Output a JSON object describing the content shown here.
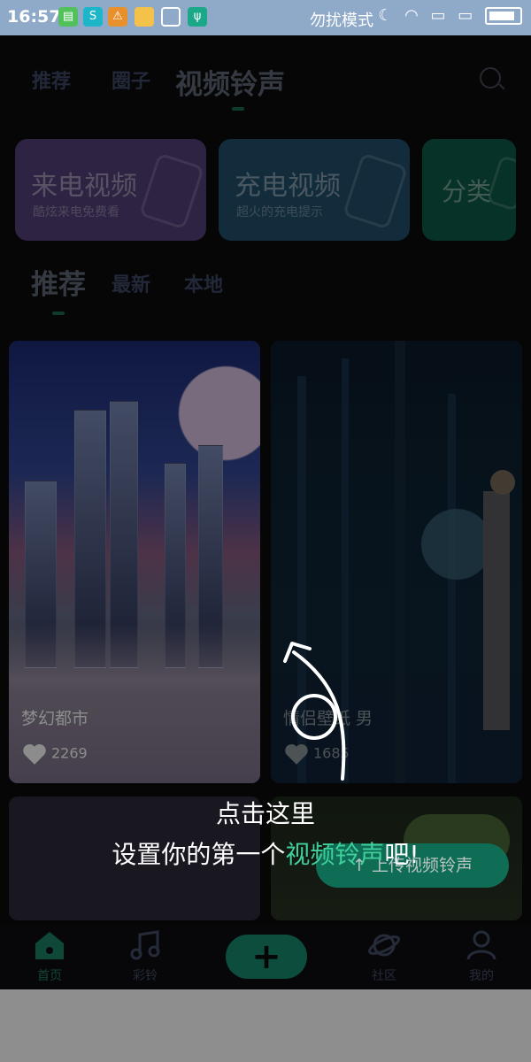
{
  "status_bar": {
    "time": "16:57",
    "dnd_text": "勿扰模式"
  },
  "top_tabs": [
    {
      "label": "推荐"
    },
    {
      "label": "圈子"
    },
    {
      "label": "视频铃声"
    }
  ],
  "category_cards": [
    {
      "title": "来电视频",
      "subtitle": "酷炫来电免费看",
      "color": "#6a4a8e"
    },
    {
      "title": "充电视频",
      "subtitle": "超火的充电提示",
      "color": "#275e80"
    },
    {
      "title": "分类",
      "subtitle": "",
      "color": "#0f6e58"
    }
  ],
  "sub_tabs": [
    {
      "label": "推荐"
    },
    {
      "label": "最新"
    },
    {
      "label": "本地"
    }
  ],
  "videos": [
    {
      "name": "梦幻都市",
      "likes": "2269"
    },
    {
      "name": "情侣壁纸 男",
      "likes": "1685"
    }
  ],
  "upload_button": {
    "label": "↑ 上传视频铃声"
  },
  "guide": {
    "line1": "点击这里",
    "line2_prefix": "设置你的第一个",
    "line2_highlight": "视频铃声",
    "line2_suffix": "吧!"
  },
  "bottom_nav": [
    {
      "label": "首页"
    },
    {
      "label": "彩铃"
    },
    {
      "label": "+"
    },
    {
      "label": "社区"
    },
    {
      "label": "我的"
    }
  ]
}
